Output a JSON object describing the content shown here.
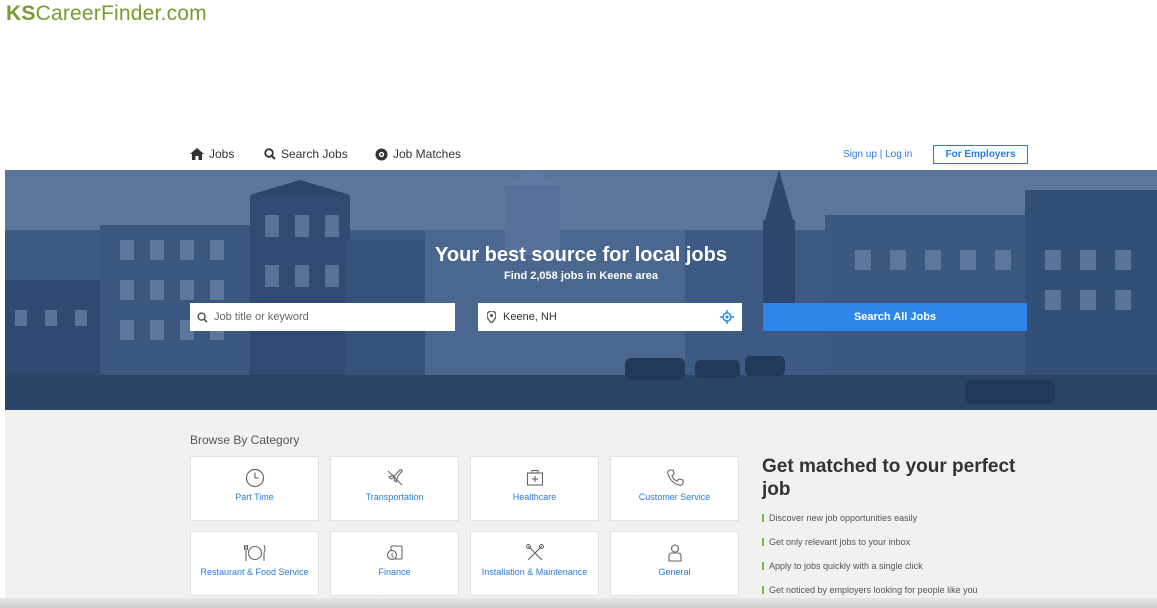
{
  "logo": {
    "ks": "KS",
    "rest": "CareerFinder.com"
  },
  "nav": {
    "jobs": "Jobs",
    "search_jobs": "Search Jobs",
    "job_matches": "Job Matches",
    "auth": "Sign up | Log in",
    "for_employers": "For Employers"
  },
  "hero": {
    "title": "Your best source for local jobs",
    "subtitle": "Find 2,058 jobs in Keene area",
    "keyword_placeholder": "Job title or keyword",
    "location_value": "Keene, NH",
    "search_button": "Search All Jobs"
  },
  "browse": {
    "title": "Browse By Category",
    "categories": [
      {
        "label": "Part Time",
        "icon": "clock-icon"
      },
      {
        "label": "Transportation",
        "icon": "airplane-icon"
      },
      {
        "label": "Healthcare",
        "icon": "medical-kit-icon"
      },
      {
        "label": "Customer Service",
        "icon": "phone-icon"
      },
      {
        "label": "Restaurant & Food Service",
        "icon": "plate-utensils-icon"
      },
      {
        "label": "Finance",
        "icon": "money-icon"
      },
      {
        "label": "Installation & Maintenance",
        "icon": "tools-icon"
      },
      {
        "label": "General",
        "icon": "person-icon"
      }
    ]
  },
  "match": {
    "title": "Get matched to your perfect job",
    "features": [
      "Discover new job opportunities easily",
      "Get only relevant jobs to your inbox",
      "Apply to jobs quickly with a single click",
      "Get noticed by employers looking for people like you"
    ]
  },
  "colors": {
    "brand": "#7a9a2e",
    "link": "#2b7ad8",
    "button": "#2d86e9",
    "hero_tint": "#33507a",
    "accent_bar": "#7fb82d"
  }
}
